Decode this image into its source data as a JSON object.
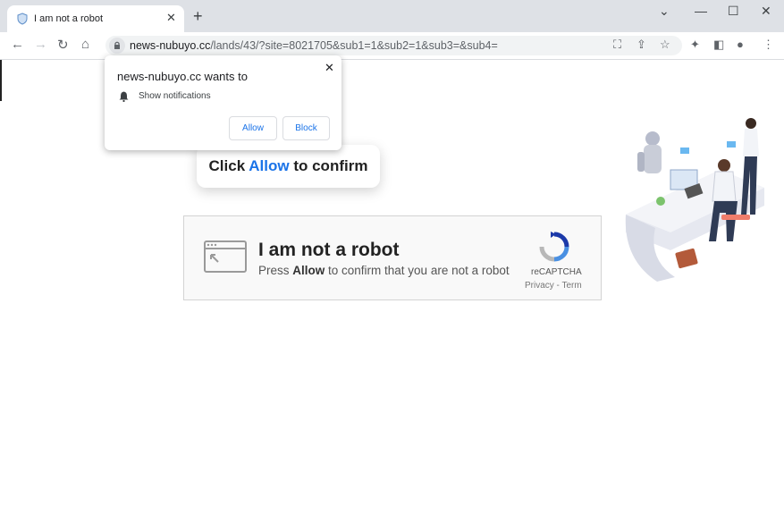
{
  "tab": {
    "title": "I am not a robot",
    "favicon": "robot-shield-icon"
  },
  "window_controls": {
    "minimize": "minimize-icon",
    "maximize": "maximize-icon",
    "close": "close-icon"
  },
  "address_bar": {
    "host": "news-nubuyo.cc",
    "path": "/lands/43/?site=8021705&sub1=1&sub2=1&sub3=&sub4="
  },
  "notification_prompt": {
    "title": "news-nubuyo.cc wants to",
    "permission": "Show notifications",
    "allow_label": "Allow",
    "block_label": "Block"
  },
  "confirm_banner": {
    "prefix": "Click ",
    "highlight": "Allow",
    "suffix": " to confirm"
  },
  "captcha": {
    "title": "I am not a robot",
    "sub_prefix": "Press ",
    "sub_bold": "Allow",
    "sub_suffix": " to confirm that you are not a robot",
    "brand": "reCAPTCHA",
    "links": "Privacy - Term"
  },
  "colors": {
    "accent": "#1a73e8",
    "tabbar": "#dee1e6",
    "omnibox": "#f1f3f4"
  }
}
